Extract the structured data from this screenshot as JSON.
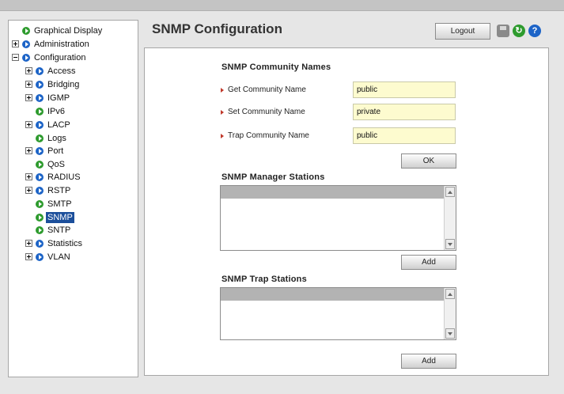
{
  "nav": {
    "items": [
      {
        "label": "Graphical Display",
        "expander": "",
        "color": "green",
        "selected": false
      },
      {
        "label": "Administration",
        "expander": "plus",
        "color": "blue",
        "selected": false
      },
      {
        "label": "Configuration",
        "expander": "minus",
        "color": "blue",
        "selected": false
      },
      {
        "label": "Access",
        "expander": "plus",
        "color": "blue",
        "selected": false
      },
      {
        "label": "Bridging",
        "expander": "plus",
        "color": "blue",
        "selected": false
      },
      {
        "label": "IGMP",
        "expander": "plus",
        "color": "blue",
        "selected": false
      },
      {
        "label": "IPv6",
        "expander": "",
        "color": "green",
        "selected": false
      },
      {
        "label": "LACP",
        "expander": "plus",
        "color": "blue",
        "selected": false
      },
      {
        "label": "Logs",
        "expander": "",
        "color": "green",
        "selected": false
      },
      {
        "label": "Port",
        "expander": "plus",
        "color": "blue",
        "selected": false
      },
      {
        "label": "QoS",
        "expander": "",
        "color": "green",
        "selected": false
      },
      {
        "label": "RADIUS",
        "expander": "plus",
        "color": "blue",
        "selected": false
      },
      {
        "label": "RSTP",
        "expander": "plus",
        "color": "blue",
        "selected": false
      },
      {
        "label": "SMTP",
        "expander": "",
        "color": "green",
        "selected": false
      },
      {
        "label": "SNMP",
        "expander": "",
        "color": "green",
        "selected": true
      },
      {
        "label": "SNTP",
        "expander": "",
        "color": "green",
        "selected": false
      },
      {
        "label": "Statistics",
        "expander": "plus",
        "color": "blue",
        "selected": false
      },
      {
        "label": "VLAN",
        "expander": "plus",
        "color": "blue",
        "selected": false
      }
    ]
  },
  "header": {
    "title": "SNMP Configuration",
    "logout_label": "Logout",
    "icons": [
      "save-icon",
      "refresh-icon",
      "help-icon"
    ],
    "help_glyph": "?",
    "refresh_glyph": "↻"
  },
  "community": {
    "section_title": "SNMP Community Names",
    "get_label": "Get Community Name",
    "get_value": "public",
    "set_label": "Set Community Name",
    "set_value": "private",
    "trap_label": "Trap Community Name",
    "trap_value": "public",
    "ok_label": "OK"
  },
  "manager": {
    "section_title": "SNMP Manager Stations",
    "add_label": "Add"
  },
  "trap": {
    "section_title": "SNMP Trap Stations",
    "add_label": "Add"
  },
  "colors": {
    "field_bg": "#fdfbcf",
    "selected_bg": "#1c4f9b",
    "node_blue": "#1d64c7",
    "node_green": "#2e9b2e"
  }
}
